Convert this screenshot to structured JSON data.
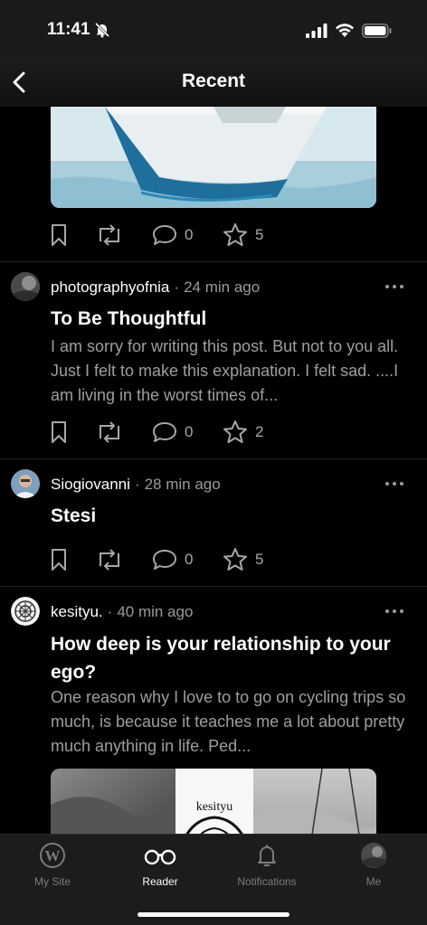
{
  "status_bar": {
    "time": "11:41"
  },
  "nav": {
    "title": "Recent"
  },
  "top_post": {
    "comments": "0",
    "likes": "5"
  },
  "posts": [
    {
      "author": "photographyofnia",
      "time_ago": "24 min ago",
      "title": "To Be Thoughtful",
      "excerpt": "I am sorry for writing this post. But not to you all. Just I felt to make this explanation. I felt sad. ....I am living in the worst times of...",
      "comments": "0",
      "likes": "2"
    },
    {
      "author": "Siogiovanni",
      "time_ago": "28 min ago",
      "title": "Stesi",
      "excerpt": "",
      "comments": "0",
      "likes": "5"
    },
    {
      "author": "kesityu.",
      "time_ago": "40 min ago",
      "title": "How deep is your relationship to your ego?",
      "excerpt": "One reason why I love to to go on cycling trips so much, is because it teaches me a lot about pretty much anything in life. Ped...",
      "image_text": "kesityu"
    }
  ],
  "tabs": [
    {
      "label": "My Site",
      "icon": "wordpress-icon"
    },
    {
      "label": "Reader",
      "icon": "glasses-icon"
    },
    {
      "label": "Notifications",
      "icon": "bell-icon"
    },
    {
      "label": "Me",
      "icon": "avatar-icon"
    }
  ],
  "colors": {
    "background": "#000000",
    "muted_text": "#9e9e9e",
    "bar": "#1c1c1c"
  }
}
